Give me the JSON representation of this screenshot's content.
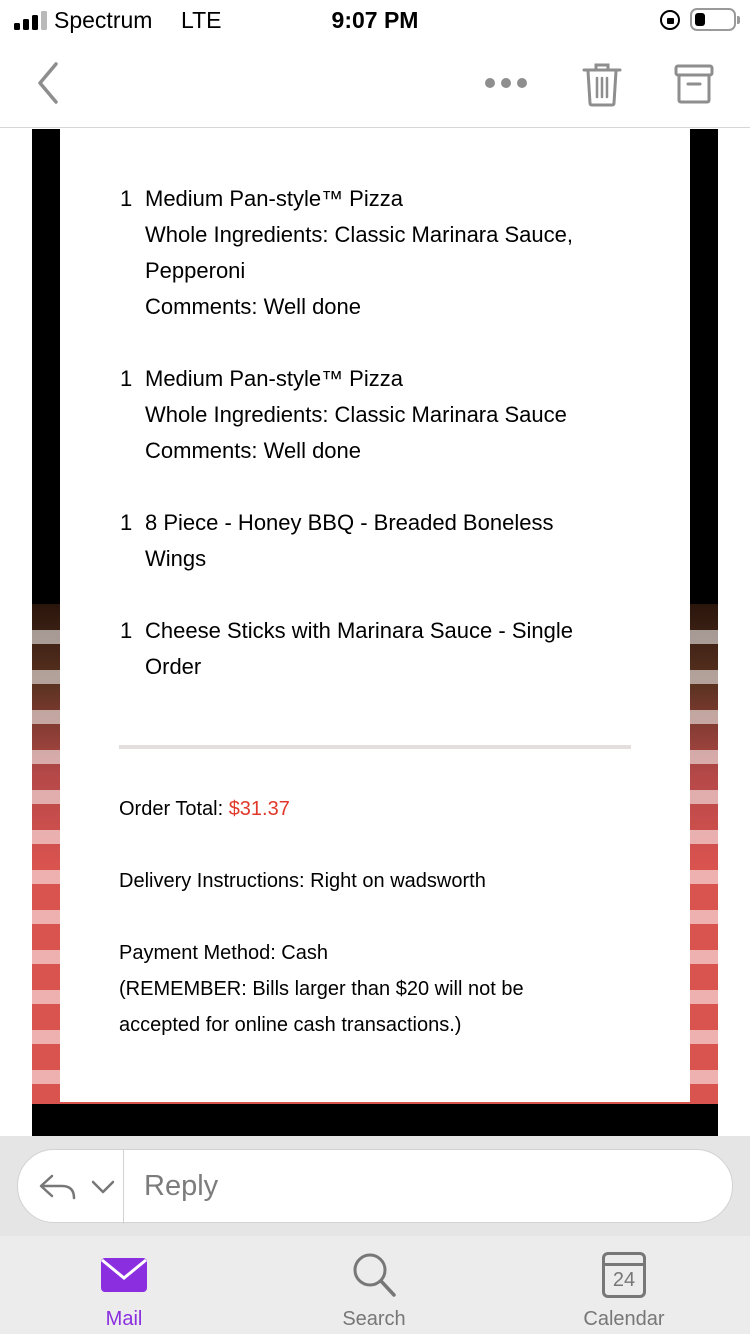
{
  "status_bar": {
    "carrier": "Spectrum",
    "network": "LTE",
    "time": "9:07 PM"
  },
  "toolbar": {
    "back_icon": "chevron-left-icon",
    "more_icon": "ellipsis-icon",
    "trash_icon": "trash-icon",
    "archive_icon": "archive-icon"
  },
  "order": {
    "items": [
      {
        "qty": "1",
        "lines": [
          "Medium Pan-style™ Pizza",
          "Whole Ingredients: Classic Marinara Sauce,",
          "Pepperoni",
          "Comments: Well done"
        ]
      },
      {
        "qty": "1",
        "lines": [
          "Medium Pan-style™ Pizza",
          "Whole Ingredients: Classic Marinara Sauce",
          "Comments: Well done"
        ]
      },
      {
        "qty": "1",
        "lines": [
          "8 Piece - Honey BBQ - Breaded Boneless",
          "Wings"
        ]
      },
      {
        "qty": "1",
        "lines": [
          "Cheese Sticks with Marinara Sauce - Single",
          "Order"
        ]
      }
    ],
    "total_label": "Order Total: ",
    "total_value": "$31.37",
    "delivery_label": "Delivery Instructions: Right on wadsworth",
    "payment_label": "Payment Method: Cash",
    "payment_note_1": "(REMEMBER: Bills larger than $20 will not be",
    "payment_note_2": "accepted for online cash transactions.)",
    "total_color": "#e0392b"
  },
  "reply": {
    "placeholder": "Reply"
  },
  "tabs": [
    {
      "label": "Mail",
      "icon": "mail-icon",
      "active": true
    },
    {
      "label": "Search",
      "icon": "search-icon",
      "active": false
    },
    {
      "label": "Calendar",
      "icon": "calendar-icon",
      "active": false,
      "day": "24"
    }
  ],
  "colors": {
    "accent": "#8a2ee0"
  }
}
